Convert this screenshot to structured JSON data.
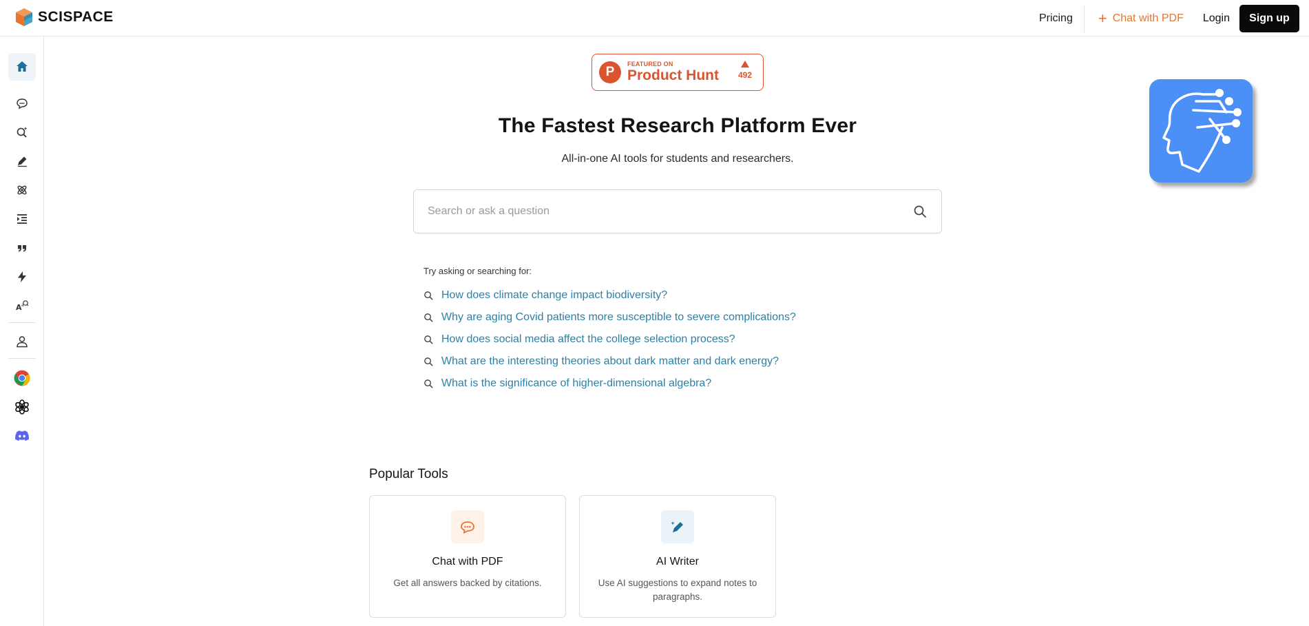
{
  "header": {
    "brand": "SCISPACE",
    "nav": {
      "pricing": "Pricing",
      "chat_pdf": "Chat with PDF",
      "login": "Login",
      "signup": "Sign up"
    }
  },
  "sidebar": {
    "items": [
      {
        "name": "home",
        "icon": "home-icon",
        "active": true
      },
      {
        "name": "chat",
        "icon": "chat-bubble-icon"
      },
      {
        "name": "search",
        "icon": "search-sparkle-icon"
      },
      {
        "name": "writer",
        "icon": "pen-icon"
      },
      {
        "name": "atom",
        "icon": "atom-icon"
      },
      {
        "name": "outline",
        "icon": "outline-list-icon"
      },
      {
        "name": "citation",
        "icon": "quote-icon"
      },
      {
        "name": "flash",
        "icon": "lightning-icon"
      },
      {
        "name": "paraphrase",
        "icon": "text-ai-icon"
      },
      {
        "name": "account",
        "icon": "user-icon"
      },
      {
        "name": "chrome",
        "icon": "chrome-icon"
      },
      {
        "name": "openai",
        "icon": "openai-icon"
      },
      {
        "name": "discord",
        "icon": "discord-icon"
      }
    ]
  },
  "product_hunt": {
    "featured": "FEATURED ON",
    "name": "Product Hunt",
    "letter": "P",
    "votes": "492"
  },
  "hero": {
    "title": "The Fastest Research Platform Ever",
    "subtitle": "All-in-one AI tools for students and researchers."
  },
  "search": {
    "placeholder": "Search or ask a question",
    "value": ""
  },
  "suggestions": {
    "label": "Try asking or searching for:",
    "items": [
      "How does climate change impact biodiversity?",
      "Why are aging Covid patients more susceptible to severe complications?",
      "How does social media affect the college selection process?",
      "What are the interesting theories about dark matter and dark energy?",
      "What is the significance of higher-dimensional algebra?"
    ]
  },
  "popular": {
    "title": "Popular Tools",
    "tools": [
      {
        "name": "Chat with PDF",
        "desc": "Get all answers backed by citations.",
        "icon": "chat-bubble-icon",
        "color": "#e6762f"
      },
      {
        "name": "AI Writer",
        "desc": "Use AI suggestions to expand notes to paragraphs.",
        "icon": "pen-sparkle-icon",
        "color": "#1c6e98"
      }
    ]
  },
  "colors": {
    "accent_orange": "#e6762f",
    "link_blue": "#2e7fa4",
    "product_hunt": "#da552f",
    "brain_bg": "#4b8ff7"
  }
}
